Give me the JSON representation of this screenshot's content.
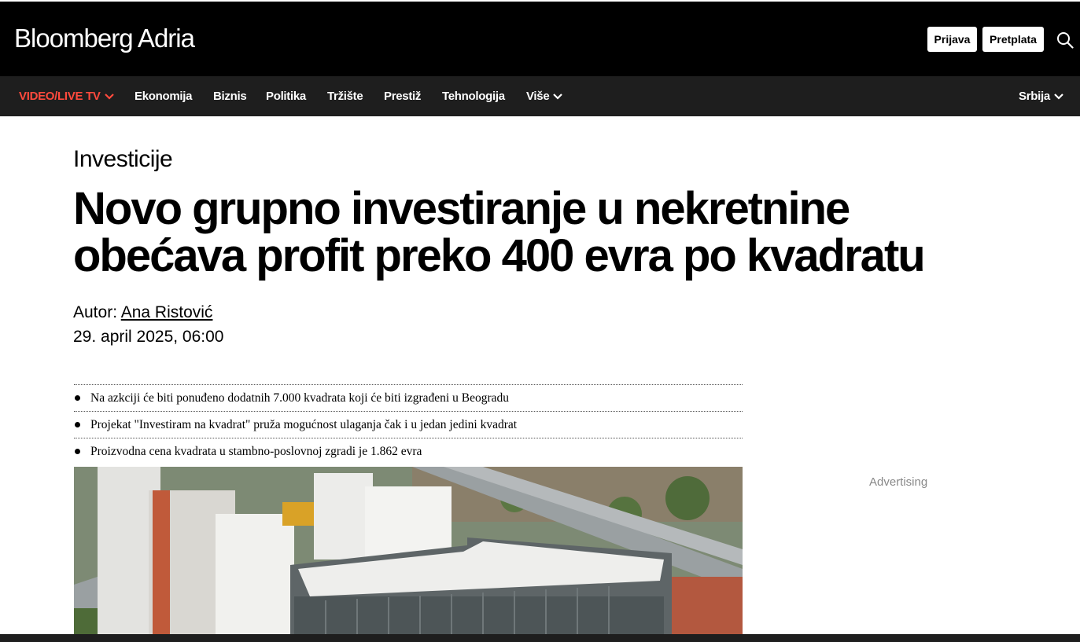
{
  "header": {
    "logo": "Bloomberg Adria",
    "login_label": "Prijava",
    "subscribe_label": "Pretplata"
  },
  "nav": {
    "items": [
      {
        "label": "VIDEO/LIVE TV"
      },
      {
        "label": "Ekonomija"
      },
      {
        "label": "Biznis"
      },
      {
        "label": "Politika"
      },
      {
        "label": "Tržište"
      },
      {
        "label": "Prestiž"
      },
      {
        "label": "Tehnologija"
      },
      {
        "label": "Više"
      }
    ],
    "region": "Srbija"
  },
  "article": {
    "category": "Investicije",
    "title": "Novo grupno investiranje u nekretnine obećava profit preko 400 evra po kvadratu",
    "author_prefix": "Autor:",
    "author": "Ana Ristović",
    "date": "29. april 2025, 06:00",
    "bullets": [
      "Na azkciji će biti ponuđeno dodatnih 7.000 kvadrata koji će biti izgrađeni u Beogradu",
      "Projekat \"Investiram na kvadrat\" pruža mogućnost ulaganja čak i u jedan jedini kvadrat",
      "Proizvodna cena kvadrata u stambno-poslovnoj zgradi je 1.862 evra"
    ]
  },
  "sidebar": {
    "advertising": "Advertising"
  },
  "colors": {
    "live_accent": "#ff4a3d",
    "header_bg": "#000000",
    "nav_bg": "#1e1e1e"
  }
}
